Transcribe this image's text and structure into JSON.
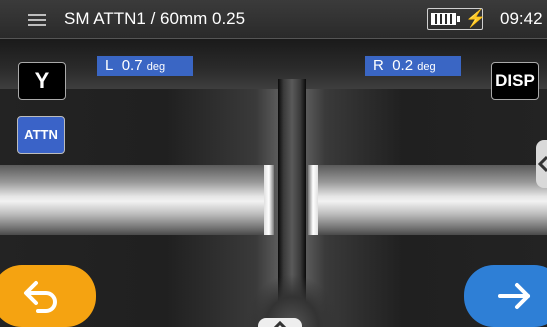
{
  "header": {
    "title": "SM ATTN1 / 60mm 0.25",
    "time": "09:42",
    "icons": {
      "menu": "menu-icon",
      "battery": "battery-icon",
      "charging": "charging-bolt-icon"
    }
  },
  "angles": {
    "left": {
      "prefix": "L",
      "value": "0.7",
      "unit": "deg"
    },
    "right": {
      "prefix": "R",
      "value": "0.2",
      "unit": "deg"
    }
  },
  "buttons": {
    "y_label": "Y",
    "attn_label": "ATTN",
    "disp_label": "DISP",
    "back_icon": "back-arrow-icon",
    "next_icon": "next-arrow-icon"
  },
  "colors": {
    "titlebar": "#2f2f2f",
    "angle_badge": "#3a66c4",
    "attn_button": "#3a63c8",
    "back_button": "#f5a311",
    "next_button": "#2e7fd6"
  }
}
